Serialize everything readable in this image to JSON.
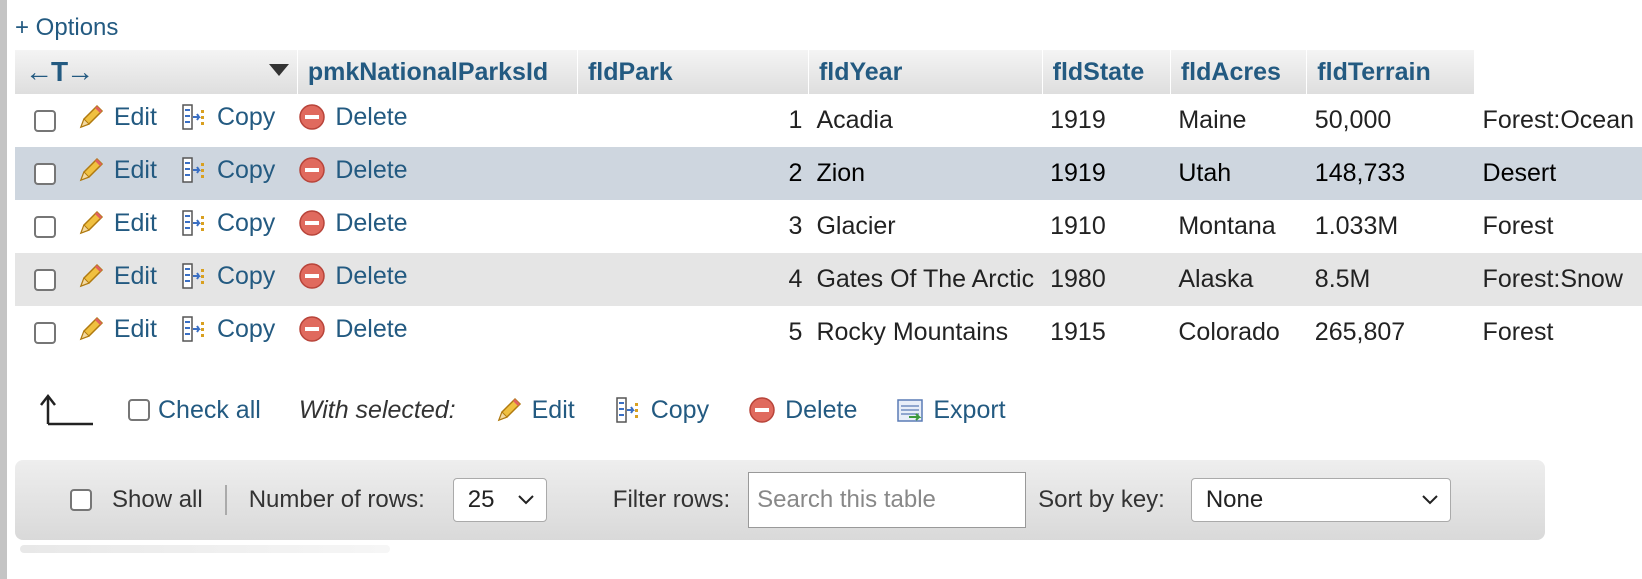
{
  "options_link": "+ Options",
  "table": {
    "columns": [
      "pmkNationalParksId",
      "fldPark",
      "fldYear",
      "fldState",
      "fldAcres",
      "fldTerrain"
    ],
    "action_labels": {
      "edit": "Edit",
      "copy": "Copy",
      "delete": "Delete"
    },
    "rows": [
      {
        "id": "1",
        "park": "Acadia",
        "year": "1919",
        "state": "Maine",
        "acres": "50,000",
        "terrain": "Forest:Ocean"
      },
      {
        "id": "2",
        "park": "Zion",
        "year": "1919",
        "state": "Utah",
        "acres": "148,733",
        "terrain": "Desert"
      },
      {
        "id": "3",
        "park": "Glacier",
        "year": "1910",
        "state": "Montana",
        "acres": "1.033M",
        "terrain": "Forest"
      },
      {
        "id": "4",
        "park": "Gates Of The Arctic",
        "year": "1980",
        "state": "Alaska",
        "acres": "8.5M",
        "terrain": "Forest:Snow"
      },
      {
        "id": "5",
        "park": "Rocky Mountains",
        "year": "1915",
        "state": "Colorado",
        "acres": "265,807",
        "terrain": "Forest"
      }
    ]
  },
  "bulk": {
    "check_all": "Check all",
    "with_selected": "With selected:",
    "edit": "Edit",
    "copy": "Copy",
    "delete": "Delete",
    "export": "Export"
  },
  "nav": {
    "show_all": "Show all",
    "rows_label": "Number of rows:",
    "rows_value": "25",
    "filter_label": "Filter rows:",
    "filter_placeholder": "Search this table",
    "sort_label": "Sort by key:",
    "sort_value": "None"
  },
  "colors": {
    "link": "#235a81",
    "row_marked": "#ced6df",
    "row_even": "#e5e5e5",
    "delete_red": "#d9534f"
  }
}
